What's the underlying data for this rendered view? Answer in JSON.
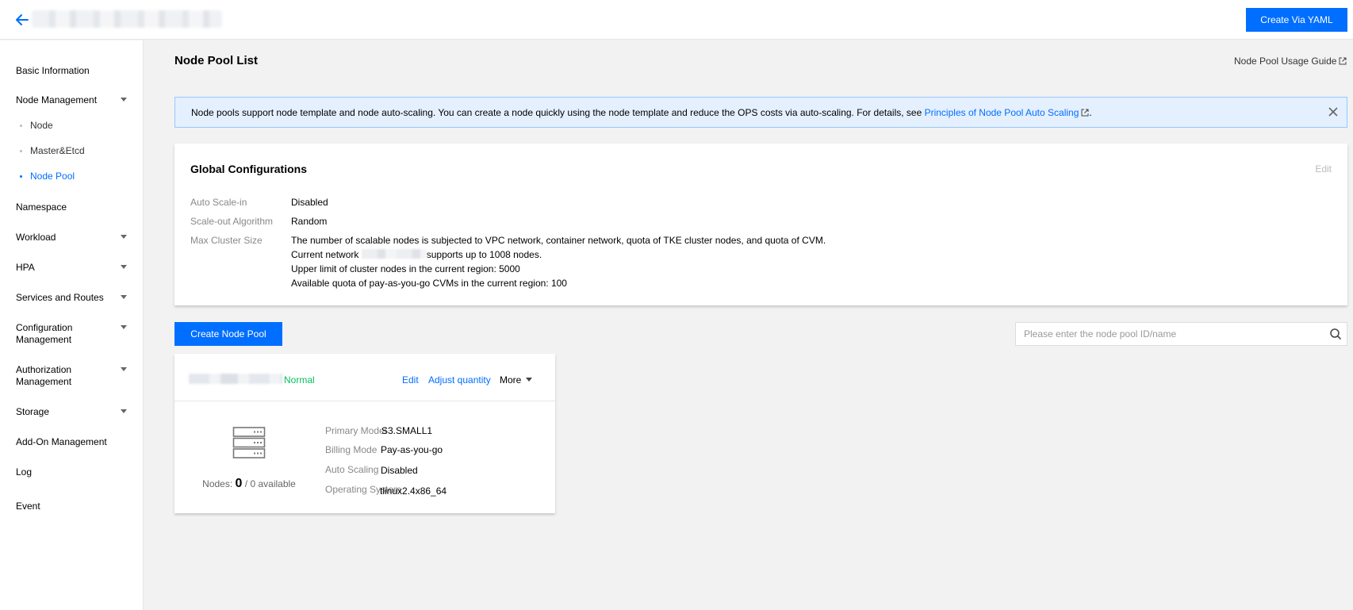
{
  "header": {
    "create_yaml_label": "Create Via YAML"
  },
  "sidebar": {
    "items": [
      {
        "label": "Basic Information"
      },
      {
        "label": "Node Management"
      },
      {
        "label": "Node"
      },
      {
        "label": "Master&Etcd"
      },
      {
        "label": "Node Pool"
      },
      {
        "label": "Namespace"
      },
      {
        "label": "Workload"
      },
      {
        "label": "HPA"
      },
      {
        "label": "Services and Routes"
      },
      {
        "label": "Configuration Management"
      },
      {
        "label": "Authorization Management"
      },
      {
        "label": "Storage"
      },
      {
        "label": "Add-On Management"
      },
      {
        "label": "Log"
      },
      {
        "label": "Event"
      }
    ],
    "active": "Node Pool"
  },
  "main": {
    "title": "Node Pool List",
    "guide_link": "Node Pool Usage Guide",
    "notice": {
      "text": "Node pools support node template and node auto-scaling. You can create a node quickly using the node template and reduce the OPS costs via auto-scaling. For details, see ",
      "link": "Principles of Node Pool Auto Scaling",
      "suffix": "."
    },
    "global_config": {
      "title": "Global Configurations",
      "edit_label": "Edit",
      "rows": [
        {
          "label": "Auto Scale-in",
          "value": "Disabled"
        },
        {
          "label": "Scale-out Algorithm",
          "value": "Random"
        },
        {
          "label": "Max Cluster Size",
          "value": "The number of scalable nodes is subjected to VPC network, container network, quota of TKE cluster nodes, and quota of CVM."
        }
      ],
      "network_prefix": "Current network",
      "network_suffix": "supports up to 1008 nodes.",
      "upper_limit": "Upper limit of cluster nodes in the current region: 5000",
      "quota": "Available quota of pay-as-you-go CVMs in the current region: 100"
    },
    "create_pool_label": "Create Node Pool",
    "search": {
      "placeholder": "Please enter the node pool ID/name"
    },
    "pool_card": {
      "status": "Normal",
      "edit_label": "Edit",
      "adjust_label": "Adjust quantity",
      "more_label": "More",
      "nodes_label": "Nodes:",
      "nodes_count": "0",
      "nodes_total": "/ 0",
      "available_label": "available",
      "props": [
        {
          "label": "Primary Model",
          "value": "S3.SMALL1"
        },
        {
          "label": "Billing Mode",
          "value": "Pay-as-you-go"
        },
        {
          "label": "Auto Scaling",
          "value": "Disabled"
        },
        {
          "label": "Operating System",
          "value": "tlinux2.4x86_64"
        }
      ]
    }
  }
}
